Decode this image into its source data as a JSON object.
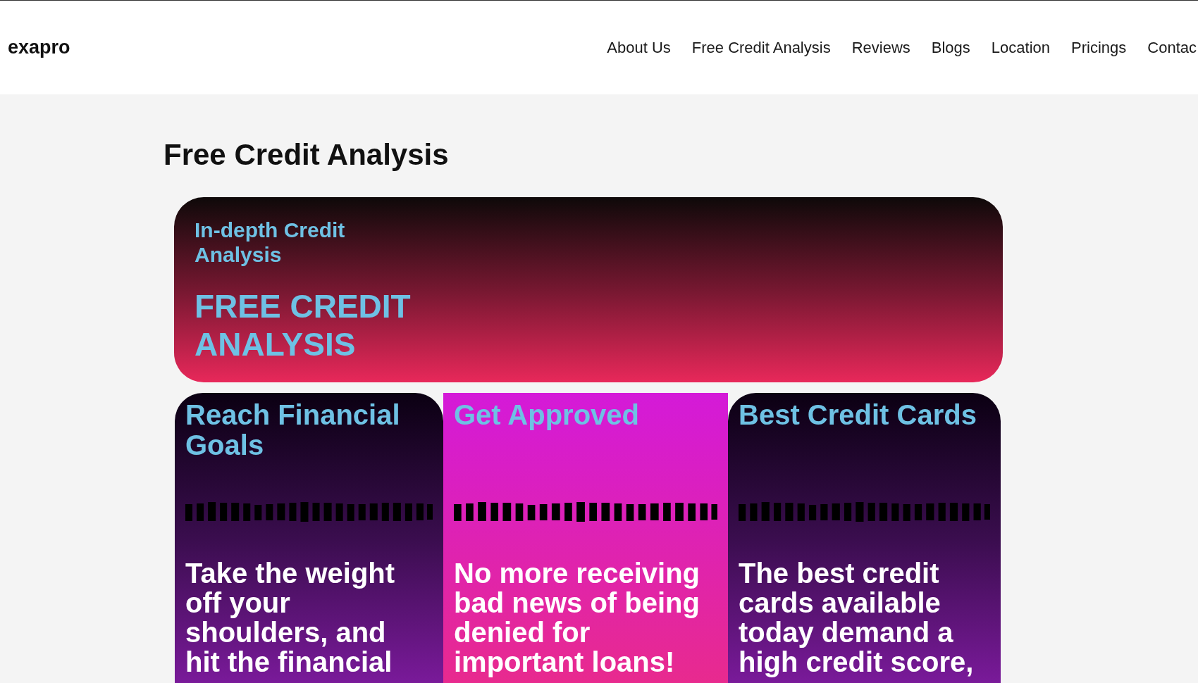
{
  "header": {
    "logo": "exapro",
    "nav": [
      "About Us",
      "Free Credit Analysis",
      "Reviews",
      "Blogs",
      "Location",
      "Pricings",
      "Contac"
    ]
  },
  "page_title": "Free Credit Analysis",
  "hero": {
    "subtitle": "In-depth Credit Analysis",
    "title": "FREE CREDIT ANALYSIS"
  },
  "cards": [
    {
      "kind": "dark",
      "title": "Reach Financial Goals",
      "text": "Take the weight off your shoulders, and hit the financial"
    },
    {
      "kind": "bright",
      "title": "Get Approved",
      "text": "No more receiving bad news of being denied for important loans!"
    },
    {
      "kind": "dark",
      "title": "Best Credit Cards",
      "text": "The best credit cards available today demand a high credit score,"
    }
  ]
}
